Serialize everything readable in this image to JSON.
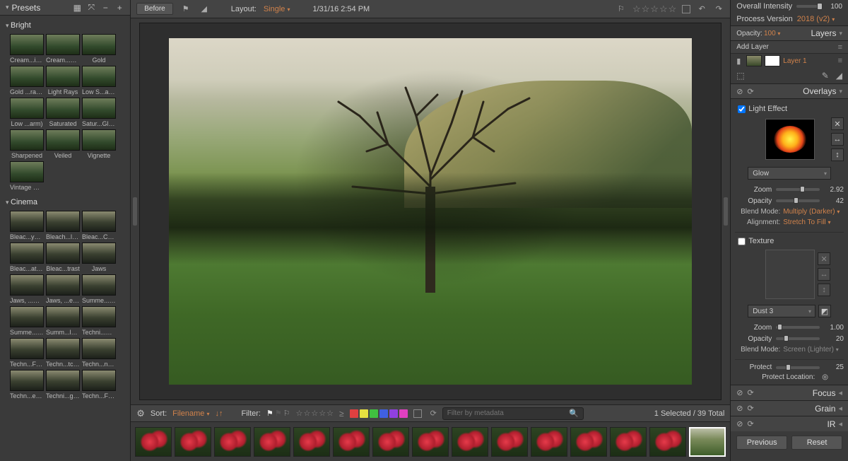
{
  "left": {
    "title": "Presets",
    "groups": [
      {
        "name": "Bright",
        "items": [
          "Cream...ights",
          "Cream...ette)",
          "Gold",
          "Gold ...rame)",
          "Light Rays",
          "Low S...ation",
          "Low ...arm)",
          "Saturated",
          "Satur...Glow)",
          "Sharpened",
          "Veiled",
          "Vignette",
          "Vintage Color"
        ]
      },
      {
        "name": "Cinema",
        "items": [
          "Bleac...ypass",
          "Bleach...lights",
          "Bleac...Cast",
          "Bleac...ation",
          "Bleac...trast",
          "Jaws",
          "Jaws, ...Shift",
          "Jaws, ...e Skin",
          "Summe...tion)",
          "Summe...tion)",
          "Summ...low)",
          "Techni...Strip)",
          "Techn...Faded",
          "Techn...tched",
          "Techn...nette",
          "Techn...ess 4",
          "Techni...grain)",
          "Techn...Faded"
        ]
      }
    ]
  },
  "top": {
    "before": "Before",
    "layout_label": "Layout:",
    "layout_value": "Single",
    "datetime": "1/31/16 2:54 PM"
  },
  "filter": {
    "sort_label": "Sort:",
    "sort_value": "Filename",
    "filter_label": "Filter:",
    "search_placeholder": "Filter by metadata",
    "count": "1 Selected / 39 Total",
    "swatches": [
      "#e04040",
      "#e6e040",
      "#40c040",
      "#4060e0",
      "#9040e0",
      "#e040c0"
    ]
  },
  "filmstrip": {
    "count": 15,
    "selected_index": 14
  },
  "right": {
    "overall_intensity_label": "Overall Intensity",
    "overall_intensity_value": "100",
    "process_version_label": "Process Version",
    "process_version_value": "2018 (v2)",
    "opacity_label": "Opacity:",
    "opacity_value": "100",
    "layers_title": "Layers",
    "add_layer": "Add Layer",
    "layer1": "Layer 1",
    "overlays_title": "Overlays",
    "light_effect": "Light Effect",
    "light_preset": "Glow",
    "zoom_label": "Zoom",
    "zoom_value": "2.92",
    "opacity2_label": "Opacity",
    "opacity2_value": "42",
    "blend_label": "Blend Mode:",
    "blend_value": "Multiply (Darker)",
    "align_label": "Alignment:",
    "align_value": "Stretch To Fill",
    "texture_label": "Texture",
    "texture_preset": "Dust  3",
    "tzoom_label": "Zoom",
    "tzoom_value": "1.00",
    "topacity_label": "Opacity",
    "topacity_value": "20",
    "tblend_label": "Blend Mode:",
    "tblend_value": "Screen (Lighter)",
    "protect_label": "Protect",
    "protect_value": "25",
    "protect_loc_label": "Protect Location:",
    "sections": [
      "Focus",
      "Grain",
      "IR"
    ],
    "previous_btn": "Previous",
    "reset_btn": "Reset"
  }
}
